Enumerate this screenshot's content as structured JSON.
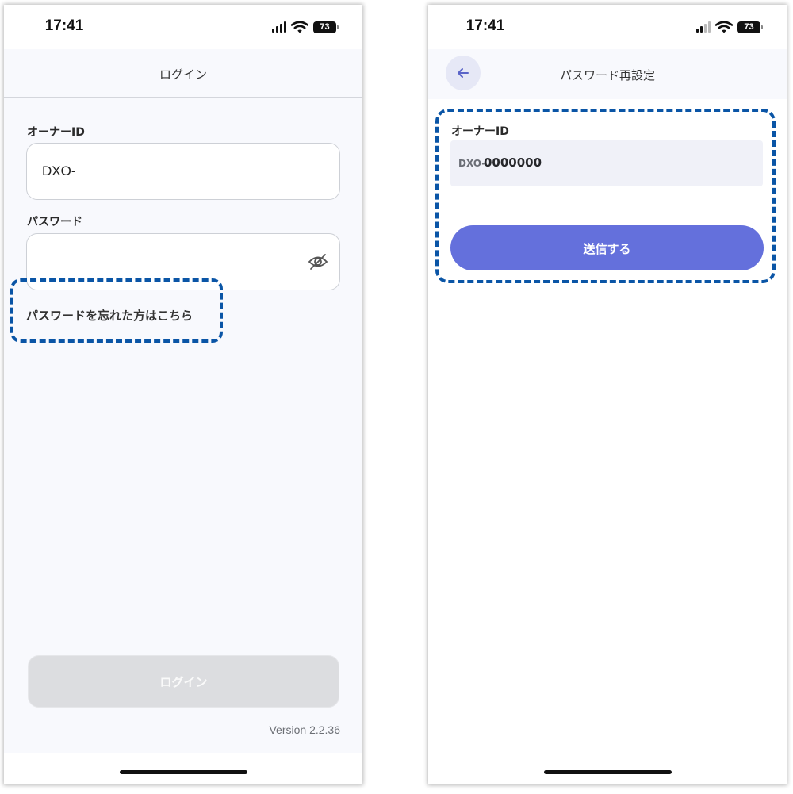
{
  "colors": {
    "highlight": "#0a55a6",
    "accent": "#6470dc",
    "disabled_button": "#dcdde0",
    "screen_background": "#f8f9fd"
  },
  "login_screen": {
    "status_bar": {
      "time": "17:41",
      "battery": "73"
    },
    "nav_title": "ログイン",
    "owner_id": {
      "label": "オーナーID",
      "value": "DXO-"
    },
    "password": {
      "label": "パスワード",
      "value": "",
      "toggle_icon": "eye-off-icon"
    },
    "forgot_password_link": "パスワードを忘れた方はこちら",
    "login_button": "ログイン",
    "version": "Version 2.2.36"
  },
  "reset_screen": {
    "status_bar": {
      "time": "17:41",
      "battery": "73"
    },
    "nav_title": "パスワード再設定",
    "back_icon": "arrow-left-icon",
    "owner_id": {
      "label": "オーナーID",
      "prefix": "DXO-",
      "value": "0000000"
    },
    "submit_button": "送信する"
  }
}
